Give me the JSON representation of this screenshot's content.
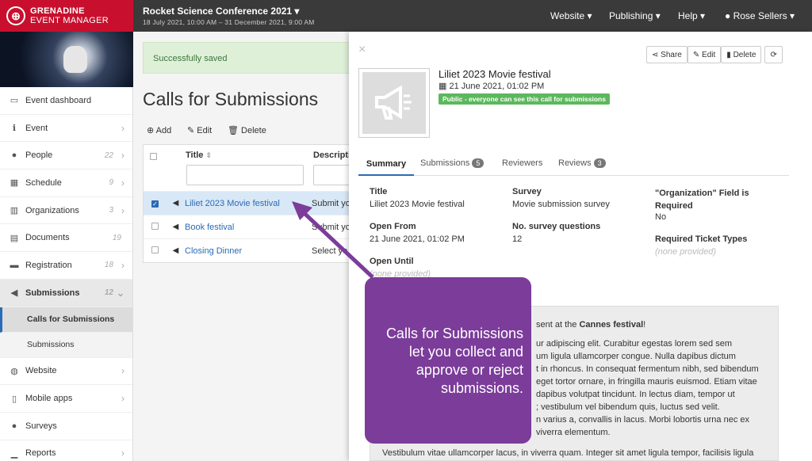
{
  "app": {
    "logo_line1": "GRENADINE",
    "logo_line2": "EVENT MANAGER"
  },
  "topbar": {
    "conference_title": "Rocket Science Conference 2021 ▾",
    "conference_dates": "18 July 2021, 10:00 AM – 31 December 2021, 9:00 AM",
    "menus": [
      "Website ▾",
      "Publishing ▾",
      "Help ▾",
      "Rose Sellers ▾"
    ]
  },
  "sidebar": {
    "items": [
      {
        "label": "Event dashboard",
        "icon": "monitor-icon",
        "count": ""
      },
      {
        "label": "Event",
        "icon": "info-icon",
        "count": ""
      },
      {
        "label": "People",
        "icon": "person-icon",
        "count": "22"
      },
      {
        "label": "Schedule",
        "icon": "calendar-icon",
        "count": "9"
      },
      {
        "label": "Organizations",
        "icon": "building-icon",
        "count": "3"
      },
      {
        "label": "Documents",
        "icon": "document-icon",
        "count": "19"
      },
      {
        "label": "Registration",
        "icon": "ticket-icon",
        "count": "18"
      },
      {
        "label": "Submissions",
        "icon": "megaphone-icon",
        "count": "12"
      },
      {
        "label": "Website",
        "icon": "globe-icon",
        "count": ""
      },
      {
        "label": "Mobile apps",
        "icon": "mobile-icon",
        "count": ""
      },
      {
        "label": "Surveys",
        "icon": "chat-icon",
        "count": ""
      },
      {
        "label": "Reports",
        "icon": "chart-icon",
        "count": ""
      }
    ],
    "sub_items": [
      "Calls for Submissions",
      "Submissions"
    ]
  },
  "main": {
    "flash": "Successfully saved",
    "page_title": "Calls for Submissions",
    "toolbar": {
      "add": "Add",
      "edit": "Edit",
      "delete": "Delete"
    },
    "table": {
      "columns": [
        "Title",
        "Descripti"
      ],
      "rows": [
        {
          "title": "Liliet 2023 Movie festival",
          "desc": "Submit yo",
          "checked": true
        },
        {
          "title": "Book festival",
          "desc": "Submit yo",
          "checked": false
        },
        {
          "title": "Closing Dinner",
          "desc": "Select yo",
          "checked": false
        }
      ]
    }
  },
  "panel": {
    "close": "×",
    "buttons": {
      "share": "Share",
      "edit": "Edit",
      "delete": "Delete"
    },
    "title": "Liliet 2023 Movie festival",
    "date": "21 June 2021, 01:02 PM",
    "visibility": "Public - everyone can see this call for submissions",
    "tabs": [
      {
        "label": "Summary",
        "badge": ""
      },
      {
        "label": "Submissions",
        "badge": "5"
      },
      {
        "label": "Reviewers",
        "badge": ""
      },
      {
        "label": "Reviews",
        "badge": "3"
      }
    ],
    "fields": {
      "title_label": "Title",
      "title_value": "Liliet 2023 Movie festival",
      "open_from_label": "Open From",
      "open_from_value": "21 June 2021, 01:02 PM",
      "open_until_label": "Open Until",
      "open_until_value": "(none provided)",
      "survey_label": "Survey",
      "survey_value": "Movie submission survey",
      "questions_label": "No. survey questions",
      "questions_value": "12",
      "org_label": "\"Organization\" Field is Required",
      "org_value": "No",
      "ticket_label": "Required Ticket Types",
      "ticket_value": "(none provided)"
    },
    "description": {
      "line0_a": "sent at the ",
      "line0_b": "Cannes festival",
      "line0_c": "!",
      "lines": [
        "ur adipiscing elit. Curabitur egestas lorem sed sem",
        "um ligula ullamcorper congue. Nulla dapibus dictum",
        "t in rhoncus. In consequat fermentum nibh, sed bibendum",
        "eget tortor ornare, in fringilla mauris euismod. Etiam vitae",
        "dapibus volutpat tincidunt. In lectus diam, tempor ut",
        "; vestibulum vel bibendum quis, luctus sed velit.",
        "n varius a, convallis in lacus. Morbi lobortis urna nec ex",
        "viverra elementum."
      ],
      "last": "Vestibulum vitae ullamcorper lacus, in viverra quam. Integer sit amet ligula tempor, facilisis ligula"
    }
  },
  "callout": {
    "text_lines": [
      "Calls for Submissions",
      "let you collect and",
      "approve or reject",
      "submissions."
    ]
  },
  "colors": {
    "brand_red": "#c8102e",
    "callout_purple": "#7b3c9a",
    "link_blue": "#2a6bb5",
    "public_green": "#5cb85c"
  }
}
